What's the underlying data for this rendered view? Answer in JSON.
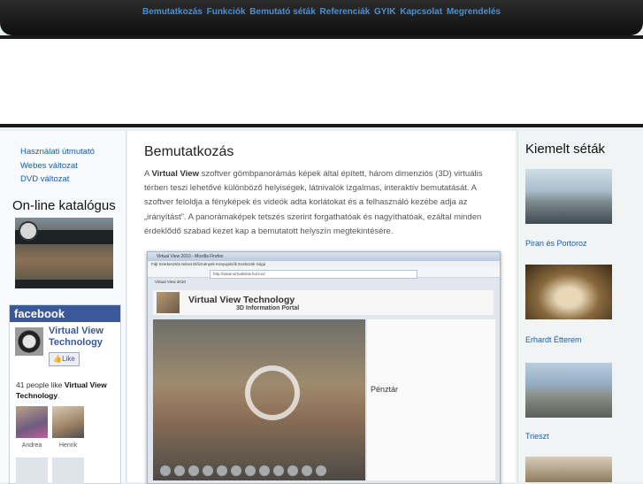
{
  "nav": [
    "Bemutatkozás",
    "Funkciók",
    "Bemutató séták",
    "Referenciák",
    "GYIK",
    "Kapcsolat",
    "Megrendelés"
  ],
  "left": {
    "links": [
      "Használati útmutató",
      "Webes változat",
      "DVD változat"
    ],
    "catalog_title": "On-line katalógus"
  },
  "facebook": {
    "brand": "facebook",
    "page_name": "Virtual View Technology",
    "like_label": "Like",
    "count_prefix": "41 people like",
    "count_name": "Virtual View Technology",
    "count_suffix": ".",
    "fans": [
      "Andrea",
      "Henrik"
    ]
  },
  "main": {
    "title": "Bemutatkozás",
    "paragraph_pre": "A ",
    "paragraph_bold": "Virtual View",
    "paragraph_post": " szoftver gömbpanorámás képek által épített, három dimenziós (3D) virtuális térben teszi lehetővé különböző helyiségek, látnivalók izgalmas, interaktív bemutatását. A szoftver feloldja a fényképek és videók adta korlátokat és a felhasználó kezébe adja az „irányítást”. A panorámaképek tetszés szerint forgathatóak és nagyíthatóak, ezáltal minden érdeklődő szabad kezet kap a bemutatott helyszín megtekintésére.",
    "screenshot": {
      "window_title": "Virtual View 2010 - Mozilla Firefox",
      "menu": "Fájl  Szerkesztés  Nézet  Előzmények  Könyvjelzők  Eszközök  Súgó",
      "url": "http://www.virtualview.hu/zoo/",
      "tab": "Virtual View 2010",
      "brand_title": "Virtual View Technology",
      "brand_sub": "3D Information Portal",
      "side_heading": "Pénztár"
    }
  },
  "right": {
    "title": "Kiemelt séták",
    "items": [
      "Piran és Portoroz",
      "Erhardt Étterem",
      "Trieszt"
    ]
  }
}
